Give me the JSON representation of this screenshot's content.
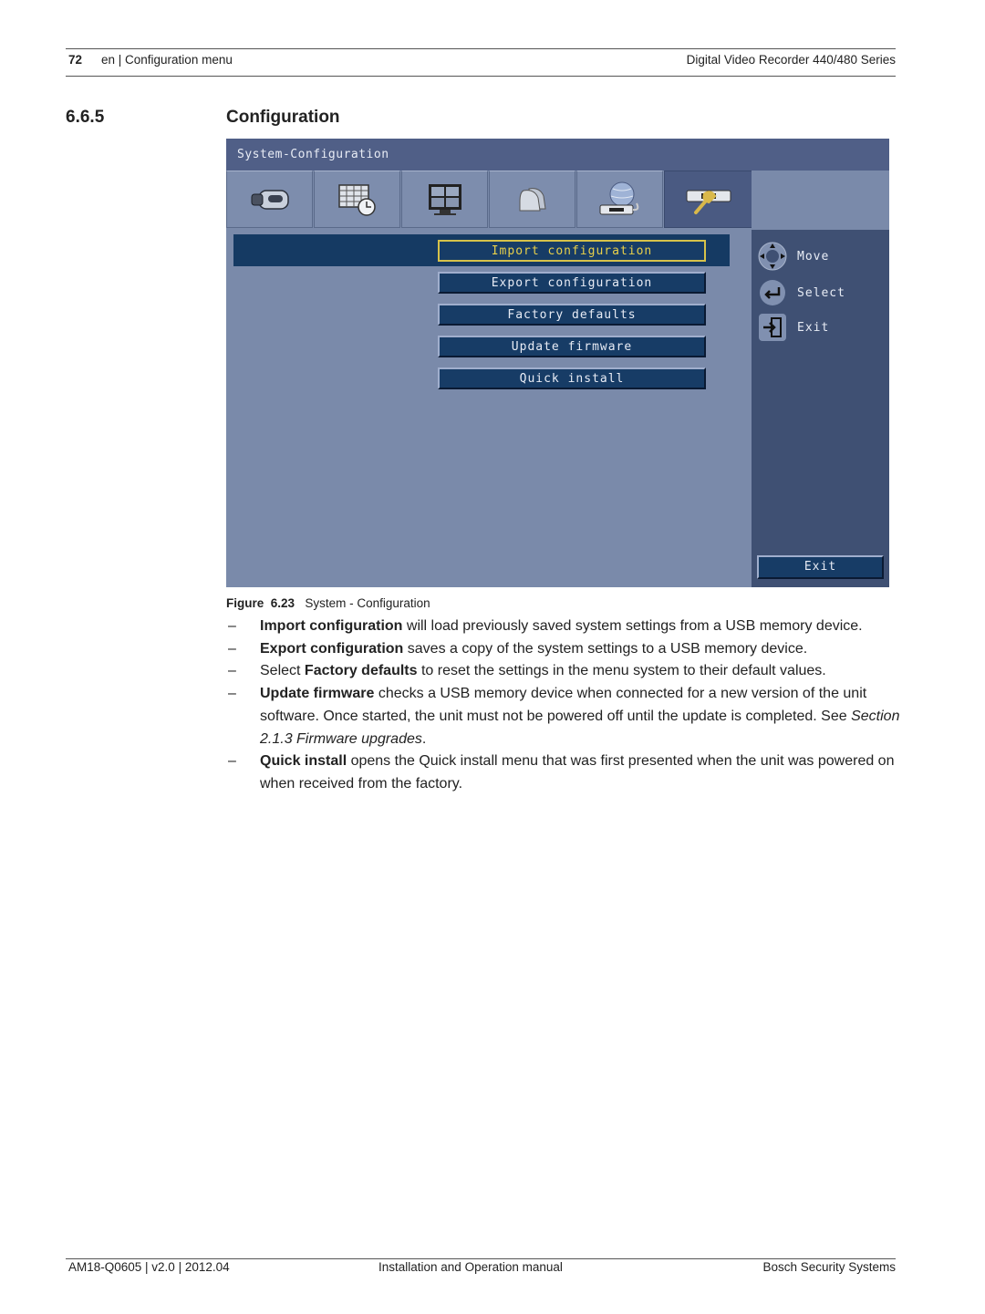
{
  "header": {
    "page_number": "72",
    "left_text": "en | Configuration menu",
    "right_text": "Digital Video Recorder 440/480 Series"
  },
  "section": {
    "number": "6.6.5",
    "title": "Configuration"
  },
  "dvr_screen": {
    "title": "System-Configuration",
    "tabs": [
      {
        "icon": "camera-icon",
        "active": false
      },
      {
        "icon": "schedule-clock-icon",
        "active": false
      },
      {
        "icon": "monitor-icon",
        "active": false
      },
      {
        "icon": "alarm-bell-icon",
        "active": false
      },
      {
        "icon": "network-globe-icon",
        "active": false
      },
      {
        "icon": "system-wrench-icon",
        "active": true
      }
    ],
    "menu_buttons": [
      {
        "label": "Import configuration",
        "selected": true
      },
      {
        "label": "Export configuration",
        "selected": false
      },
      {
        "label": "Factory defaults",
        "selected": false
      },
      {
        "label": "Update firmware",
        "selected": false
      },
      {
        "label": "Quick install",
        "selected": false
      }
    ],
    "hints": [
      {
        "icon": "dpad-move-icon",
        "label": "Move"
      },
      {
        "icon": "enter-select-icon",
        "label": "Select"
      },
      {
        "icon": "exit-door-icon",
        "label": "Exit"
      }
    ],
    "exit_button": "Exit",
    "colors": {
      "title_bar": "#505f87",
      "panel": "#7a8aaa",
      "side_panel": "#3f5073",
      "button": "#173c66",
      "selected_border": "#d6c24a"
    }
  },
  "figure": {
    "label": "Figure",
    "number": "6.23",
    "caption": "System - Configuration"
  },
  "bullets": [
    {
      "bold": "Import configuration",
      "text": " will load previously saved system settings from a USB memory device.",
      "pre": ""
    },
    {
      "bold": "Export configuration",
      "text": " saves a copy of the system settings to a USB memory device.",
      "pre": ""
    },
    {
      "pre": "Select ",
      "bold": "Factory defaults",
      "text": " to reset the settings in the menu system to their default values."
    },
    {
      "bold": "Update firmware",
      "text": " checks a USB memory device when connected for a new version of the unit software. Once started, the unit must not be powered off until the update is completed. See ",
      "italic": "Section 2.1.3 Firmware upgrades",
      "post": ".",
      "pre": ""
    },
    {
      "bold": "Quick install",
      "text": " opens the Quick install menu that was first presented when the unit was powered on when received from the factory.",
      "pre": ""
    }
  ],
  "bullet_marker": "–",
  "footer": {
    "left": "AM18-Q0605 | v2.0 | 2012.04",
    "center": "Installation and Operation manual",
    "right": "Bosch Security Systems"
  }
}
